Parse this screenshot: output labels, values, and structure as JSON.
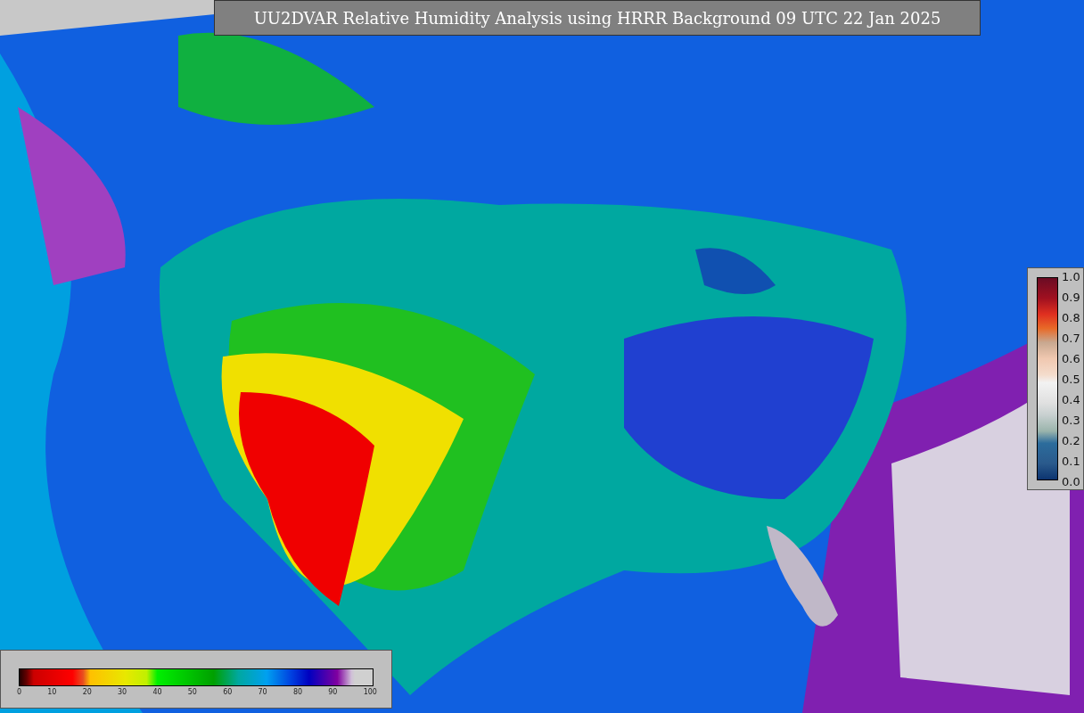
{
  "title": "UU2DVAR Relative Humidity Analysis using HRRR Background 09 UTC 22 Jan 2025",
  "humidity_scale": {
    "ticks": [
      "0",
      "10",
      "20",
      "30",
      "40",
      "50",
      "60",
      "70",
      "80",
      "90",
      "100"
    ]
  },
  "fraction_scale": {
    "ticks": [
      "1.0",
      "0.9",
      "0.8",
      "0.7",
      "0.6",
      "0.5",
      "0.4",
      "0.3",
      "0.2",
      "0.1",
      "0.0"
    ]
  }
}
